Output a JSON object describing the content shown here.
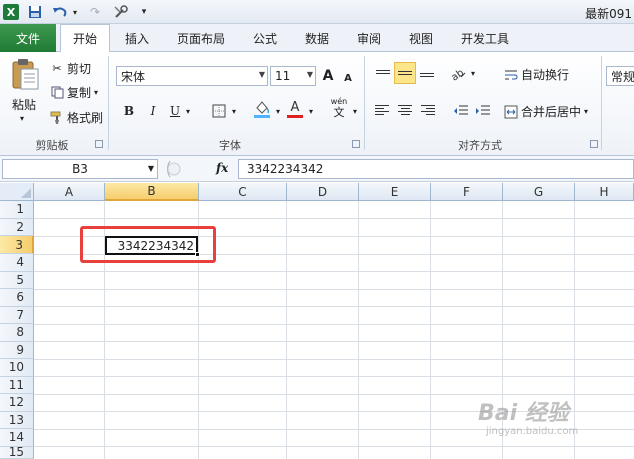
{
  "window": {
    "title": "最新091"
  },
  "quick_access": {
    "icons": [
      "excel-logo",
      "save-icon",
      "undo-icon",
      "redo-icon",
      "customize-icon"
    ]
  },
  "tabs": [
    {
      "label": "文件",
      "active": false
    },
    {
      "label": "开始",
      "active": true
    },
    {
      "label": "插入",
      "active": false
    },
    {
      "label": "页面布局",
      "active": false
    },
    {
      "label": "公式",
      "active": false
    },
    {
      "label": "数据",
      "active": false
    },
    {
      "label": "审阅",
      "active": false
    },
    {
      "label": "视图",
      "active": false
    },
    {
      "label": "开发工具",
      "active": false
    }
  ],
  "ribbon": {
    "clipboard": {
      "paste": "粘贴",
      "cut": "剪切",
      "copy": "复制",
      "format_painter": "格式刷",
      "group_label": "剪贴板"
    },
    "font": {
      "font_name": "宋体",
      "font_size": "11",
      "bold": "B",
      "italic": "I",
      "underline": "U",
      "font_color_glyph": "A",
      "phonetic_glyph": "wén",
      "phonetic_char": "文",
      "grow": "A",
      "shrink": "A",
      "group_label": "字体"
    },
    "alignment": {
      "wrap_text": "自动换行",
      "merge_center": "合并后居中",
      "group_label": "对齐方式"
    },
    "number": {
      "format": "常规"
    }
  },
  "formula_bar": {
    "name_box": "B3",
    "fx_label": "fx",
    "content": "3342234342"
  },
  "sheet": {
    "columns": [
      "A",
      "B",
      "C",
      "D",
      "E",
      "F",
      "G",
      "H"
    ],
    "rows": [
      "1",
      "2",
      "3",
      "4",
      "5",
      "6",
      "7",
      "8",
      "9",
      "10",
      "11",
      "12",
      "13",
      "14",
      "15"
    ],
    "selected_column": "B",
    "selected_row": "3",
    "active_cell_value": "3342234342"
  },
  "watermark": {
    "text": "Bai 经验",
    "sub": "jingyan.baidu.com"
  },
  "colors": {
    "file_tab": "#1f7a35",
    "selection": "#f5cd6d",
    "highlight_box": "#e8403c"
  }
}
